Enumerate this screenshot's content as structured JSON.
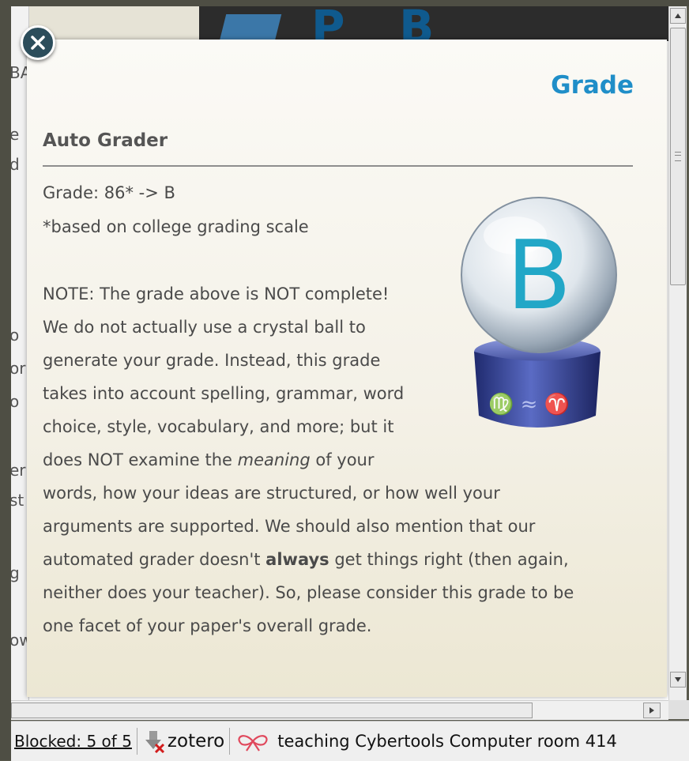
{
  "popup": {
    "title": "Grade",
    "section_heading": "Auto Grader",
    "grade_line": "Grade: 86* -> B",
    "scale_note": "*based on college grading scale",
    "crystal_ball_letter": "B",
    "note_lines": [
      "NOTE: The grade above is NOT complete!",
      "We do not actually use a crystal ball to",
      "generate your grade. Instead, this grade",
      "takes into account spelling, grammar, word",
      "choice, style, vocabulary, and more; but it"
    ],
    "line_meaning_pre": "does NOT examine the ",
    "line_meaning_em": "meaning",
    "line_meaning_post": " of your",
    "line_words": "words, how your ideas are structured, or how well your",
    "line_arguments": "arguments are supported. We should also mention that our",
    "line_always_pre": "automated grader doesn't ",
    "line_always_bold": "always",
    "line_always_post": " get things right (then again,",
    "line_neither": "neither does your teacher). So, please consider this grade to be",
    "line_facet": "one facet of your paper's overall grade."
  },
  "background": {
    "left_fragments": [
      "BA",
      "e",
      "d",
      "o",
      "or",
      "o",
      "er",
      "st",
      "g",
      "ow"
    ]
  },
  "statusbar": {
    "blocked": "Blocked: 5 of 5",
    "zotero": "zotero",
    "teaching": "teaching Cybertools Computer room 414"
  },
  "colors": {
    "accent": "#1f8ec8",
    "ball_letter": "#22a7c7",
    "close_button": "#2c4d5b"
  }
}
